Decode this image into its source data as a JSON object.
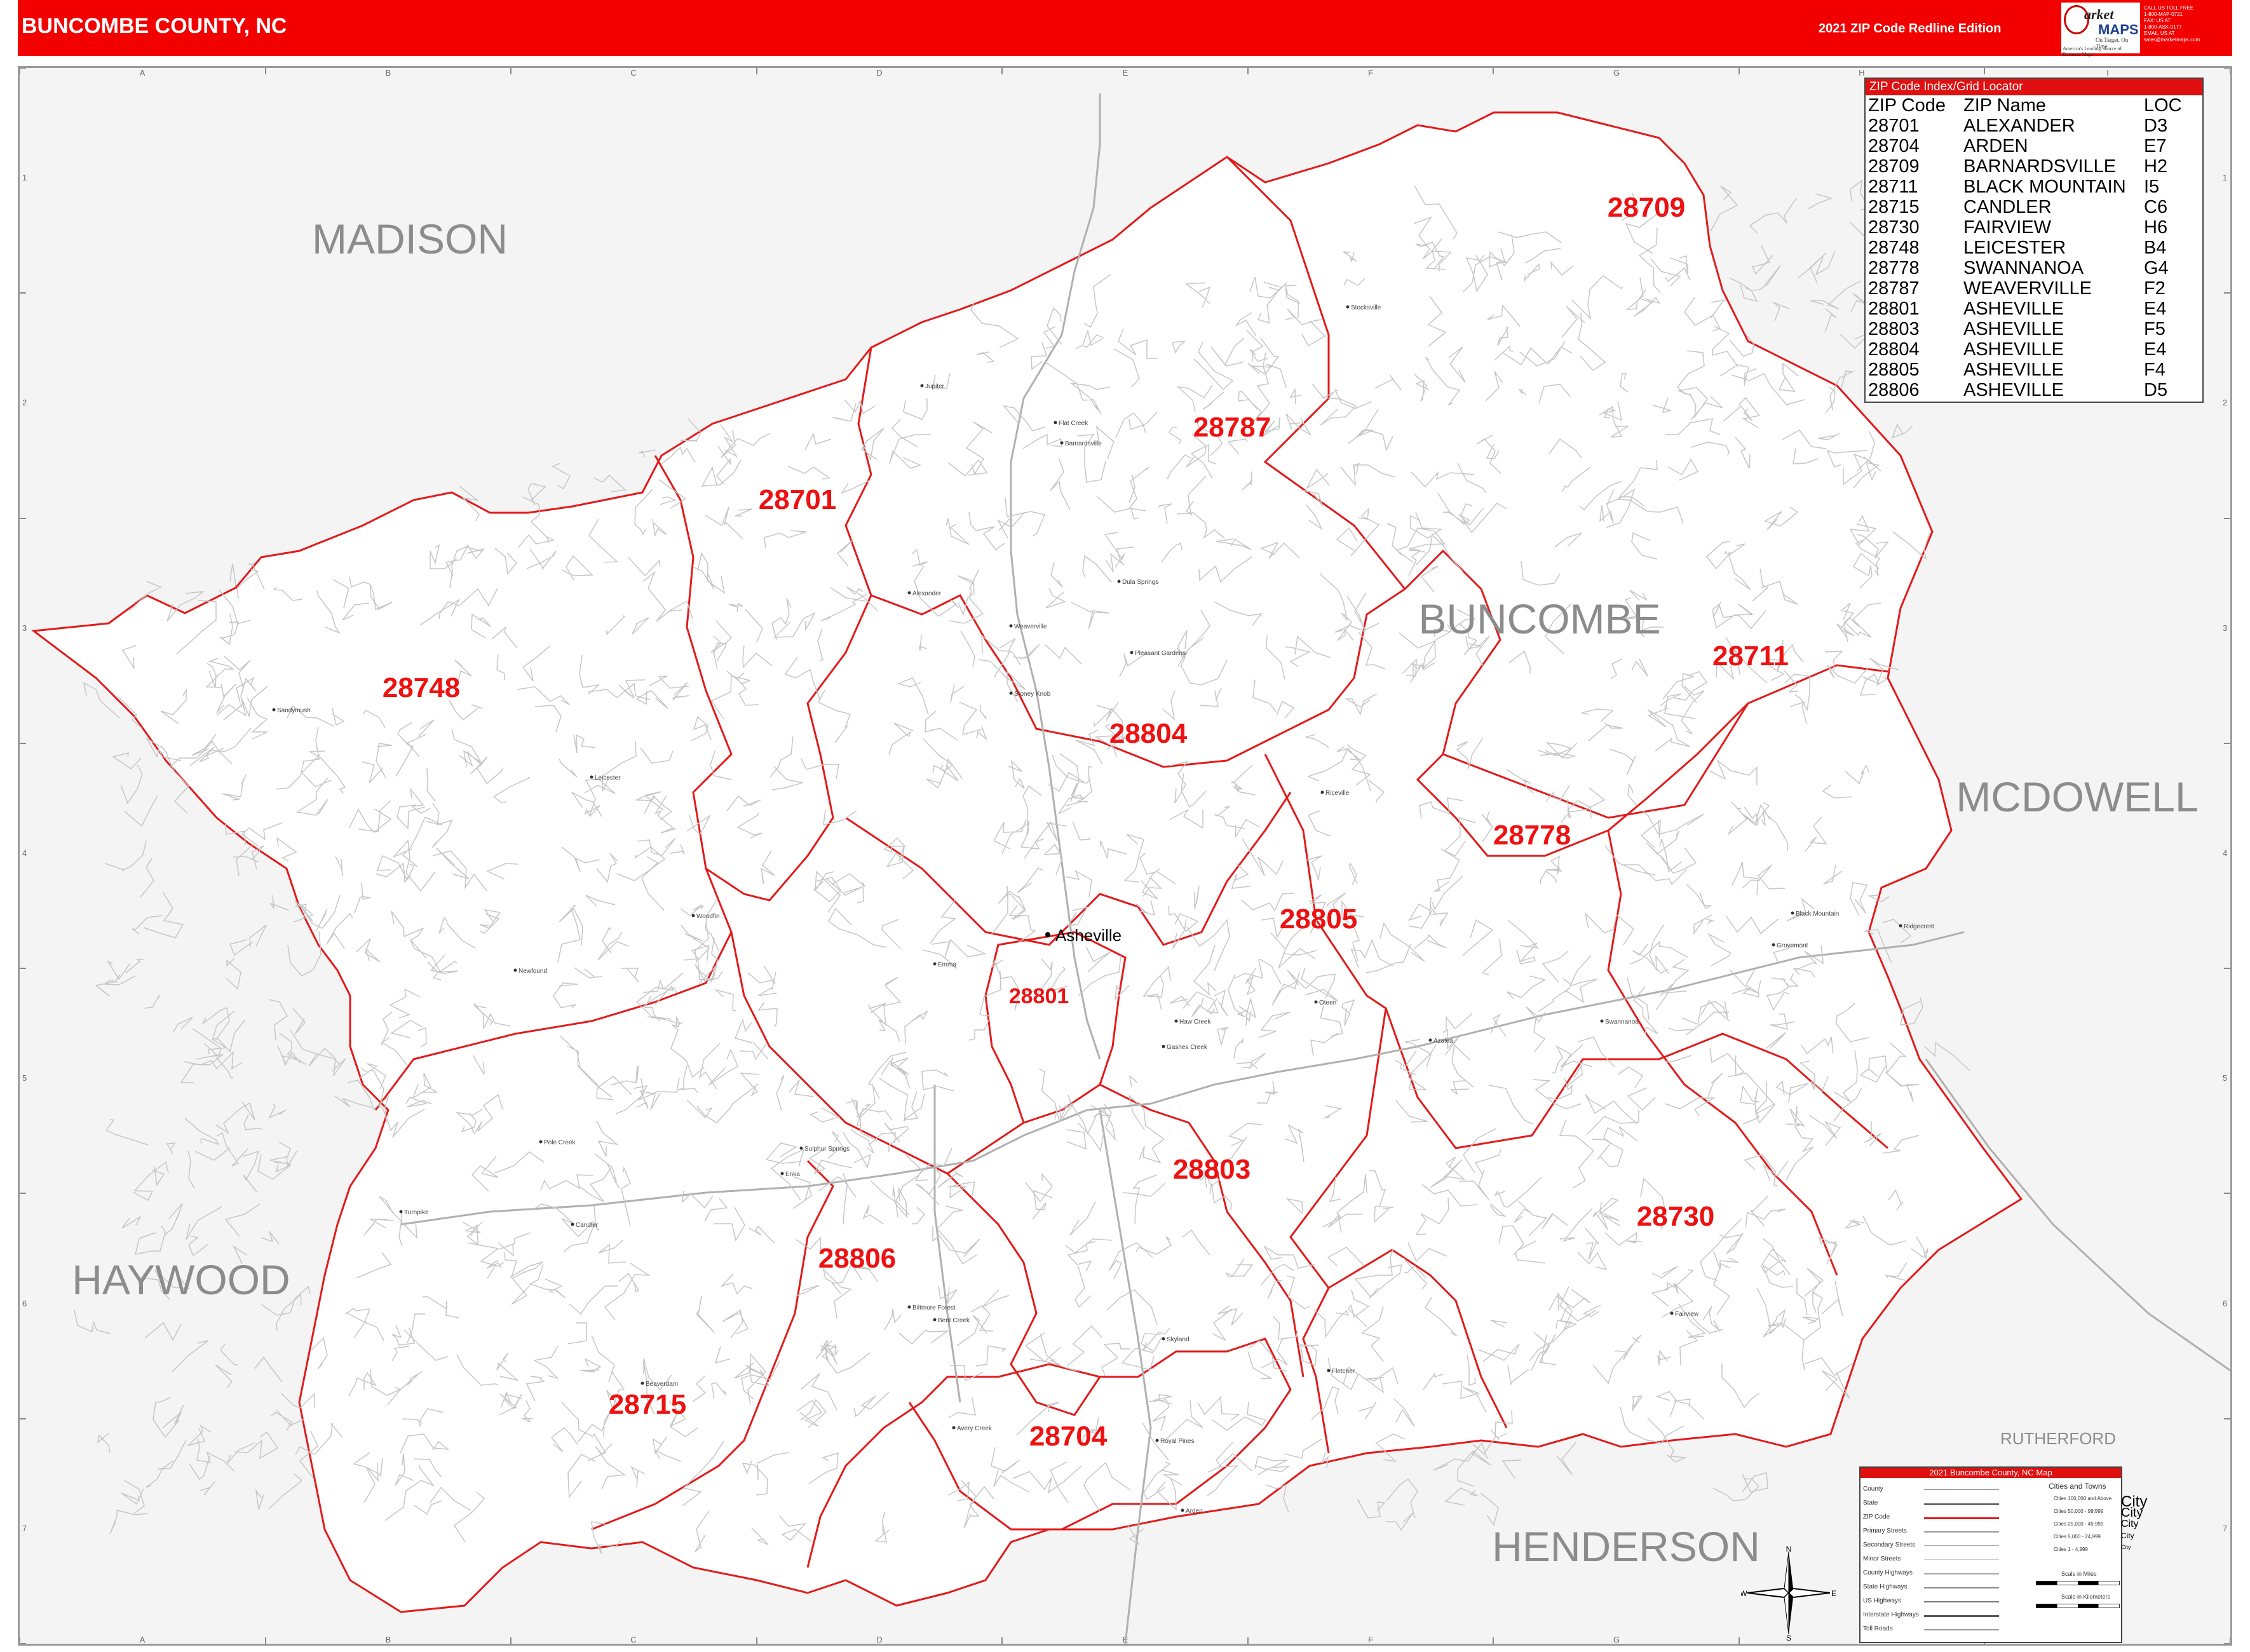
{
  "header": {
    "title": "BUNCOMBE COUNTY, NC",
    "edition": "2021 ZIP Code Redline Edition",
    "logo_line1": "arket",
    "logo_line2": "MAPS",
    "logo_line3": "On Target. On Time.",
    "logo_line4": "America's Leading Source of Business Maps",
    "contact": [
      "CALL US TOLL FREE",
      "1-800-MAP-0721",
      "FAX: US AT",
      "1-800-ASK-0177",
      "EMAIL US AT",
      "sales@marketmaps.com"
    ]
  },
  "colors": {
    "brand_red": "#f20000",
    "zip_boundary": "#e31a1a",
    "county_name": "#8c8c8c",
    "background": "#f4f4f4"
  },
  "grid": {
    "columns": [
      "A",
      "B",
      "C",
      "D",
      "E",
      "F",
      "G",
      "H",
      "I"
    ],
    "rows": [
      "1",
      "2",
      "3",
      "4",
      "5",
      "6",
      "7"
    ]
  },
  "map": {
    "counties": [
      {
        "name": "MADISON"
      },
      {
        "name": "BUNCOMBE"
      },
      {
        "name": "MCDOWELL"
      },
      {
        "name": "HAYWOOD"
      },
      {
        "name": "HENDERSON"
      },
      {
        "name": "RUTHERFORD"
      }
    ],
    "zip_labels": [
      "28709",
      "28787",
      "28701",
      "28748",
      "28711",
      "28804",
      "28778",
      "28805",
      "28801",
      "28803",
      "28730",
      "28806",
      "28715",
      "28704"
    ],
    "city": "Asheville",
    "towns": [
      "Jupiter",
      "Flat Creek",
      "Barnardsville",
      "Stocksville",
      "Dula Springs",
      "Alexander",
      "Weaverville",
      "Pleasant Gardens",
      "Stoney Knob",
      "Leicester",
      "Sandymush",
      "Newfound",
      "Woodfin",
      "Emma",
      "Candler",
      "Enka",
      "Turnpike",
      "Pole Creek",
      "Sulphur Springs",
      "Avery Creek",
      "Royal Pines",
      "Arden",
      "Skyland",
      "Fletcher",
      "Fairview",
      "Oteen",
      "Azalea",
      "Swannanoa",
      "Black Mountain",
      "Ridgecrest",
      "Grovemont",
      "Biltmore Forest",
      "Beaverdam",
      "Bent Creek",
      "Gashes Creek",
      "Haw Creek",
      "Riceville"
    ]
  },
  "zip_index": {
    "title": "ZIP Code Index/Grid Locator",
    "headers": [
      "ZIP Code",
      "ZIP Name",
      "LOC"
    ],
    "rows": [
      [
        "28701",
        "ALEXANDER",
        "D3"
      ],
      [
        "28704",
        "ARDEN",
        "E7"
      ],
      [
        "28709",
        "BARNARDSVILLE",
        "H2"
      ],
      [
        "28711",
        "BLACK MOUNTAIN",
        "I5"
      ],
      [
        "28715",
        "CANDLER",
        "C6"
      ],
      [
        "28730",
        "FAIRVIEW",
        "H6"
      ],
      [
        "28748",
        "LEICESTER",
        "B4"
      ],
      [
        "28778",
        "SWANNANOA",
        "G4"
      ],
      [
        "28787",
        "WEAVERVILLE",
        "F2"
      ],
      [
        "28801",
        "ASHEVILLE",
        "E4"
      ],
      [
        "28803",
        "ASHEVILLE",
        "F5"
      ],
      [
        "28804",
        "ASHEVILLE",
        "E4"
      ],
      [
        "28805",
        "ASHEVILLE",
        "F4"
      ],
      [
        "28806",
        "ASHEVILLE",
        "D5"
      ]
    ]
  },
  "legend": {
    "title": "2021 Buncombe County, NC Map",
    "lines": [
      "County",
      "State",
      "ZIP Code",
      "Primary Streets",
      "Secondary Streets",
      "Minor Streets",
      "County Highways",
      "State Highways",
      "US Highways",
      "Interstate Highways",
      "Toll Roads"
    ],
    "cities_title": "Cities and Towns",
    "cities": [
      "Cities 100,000 and Above",
      "Cities 50,000 - 99,999",
      "Cities 25,000 - 49,999",
      "Cities 5,000 - 24,999",
      "Cities 1 - 4,999"
    ],
    "city_samples": [
      "City",
      "City",
      "City",
      "City",
      "City"
    ],
    "scale_miles": "Scale in Miles",
    "scale_km": "Scale in Kilometers"
  },
  "compass": {
    "n": "N",
    "s": "S",
    "e": "E",
    "w": "W"
  }
}
